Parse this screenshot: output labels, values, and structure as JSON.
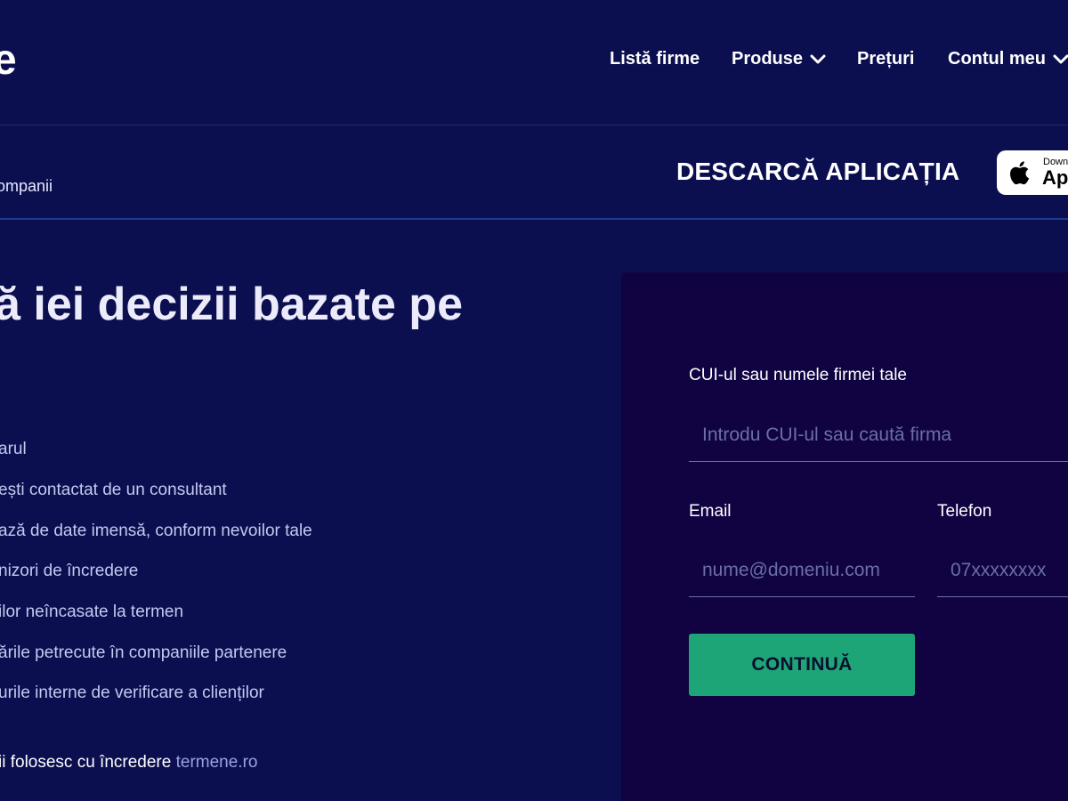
{
  "header": {
    "logo_fragment": "e",
    "nav": {
      "lista_firme": "Listă firme",
      "produse": "Produse",
      "preturi": "Prețuri",
      "contul_meu": "Contul meu"
    }
  },
  "subbar": {
    "left_text": "ompanii",
    "download_title": "DESCARCĂ APLICAȚIA",
    "appstore_small": "Down",
    "appstore_big": "Ap"
  },
  "hero": {
    "headline": "ă iei decizii bazate pe"
  },
  "features": [
    "arul",
    "ești contactat de un consultant",
    "ază de date imensă, conform nevoilor tale",
    "nizori de încredere",
    "ilor neîncasate la termen",
    "ările petrecute în companiile partenere",
    "urile interne de verificare a clienților"
  ],
  "trust": {
    "text": "ii folosesc cu încredere ",
    "brand": "termene.ro"
  },
  "form": {
    "company_label": "CUI-ul sau numele firmei tale",
    "company_placeholder": "Introdu CUI-ul sau caută firma",
    "email_label": "Email",
    "email_placeholder": "nume@domeniu.com",
    "phone_label": "Telefon",
    "phone_placeholder": "07xxxxxxxx",
    "submit_label": "CONTINUĂ"
  },
  "colors": {
    "background": "#0b0f4f",
    "panel": "#110342",
    "accent_button": "#1ea577",
    "link": "#9aa3de"
  }
}
